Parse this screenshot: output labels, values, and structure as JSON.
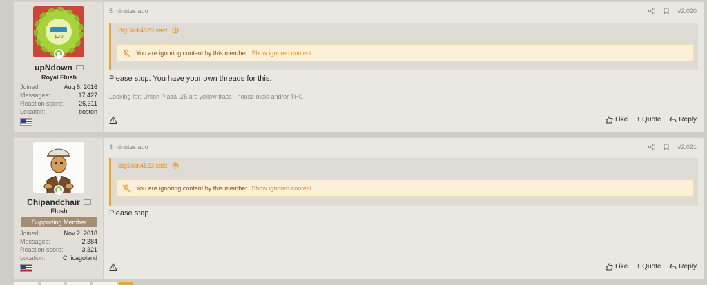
{
  "posts": [
    {
      "user": {
        "name": "upNdown",
        "title": "Royal Flush",
        "badge": "",
        "stats": [
          {
            "label": "Joined:",
            "value": "Aug 8, 2016"
          },
          {
            "label": "Messages:",
            "value": "17,427"
          },
          {
            "label": "Reaction score:",
            "value": "26,311"
          },
          {
            "label": "Location:",
            "value": "boston"
          }
        ]
      },
      "time": "5 minutes ago",
      "post_number": "#2,020",
      "quote": {
        "author": "BigSlick4523 said:",
        "ignore_text": "You are ignoring content by this member.",
        "ignore_link": "Show ignored content"
      },
      "body": "Please stop. You have your own threads for this.",
      "signature": "Looking for: Union Plaza .25 arc yellow fracs - house mold and/or THC",
      "actions": {
        "like": "Like",
        "quote": "Quote",
        "reply": "Reply"
      }
    },
    {
      "user": {
        "name": "Chipandchair",
        "title": "Flush",
        "badge": "Supporting Member",
        "stats": [
          {
            "label": "Joined:",
            "value": "Nov 2, 2018"
          },
          {
            "label": "Messages:",
            "value": "2,384"
          },
          {
            "label": "Reaction score:",
            "value": "3,321"
          },
          {
            "label": "Location:",
            "value": "Chicagoland"
          }
        ]
      },
      "time": "3 minutes ago",
      "post_number": "#2,021",
      "quote": {
        "author": "BigSlick4523 said:",
        "ignore_text": "You are ignoring content by this member.",
        "ignore_link": "Show ignored content"
      },
      "body": "Please stop",
      "signature": "",
      "actions": {
        "like": "Like",
        "quote": "Quote",
        "reply": "Reply"
      }
    }
  ],
  "colors": {
    "accent": "#e98a1a",
    "ignore_bg": "#fcefd8",
    "badge": "#a48d70"
  }
}
